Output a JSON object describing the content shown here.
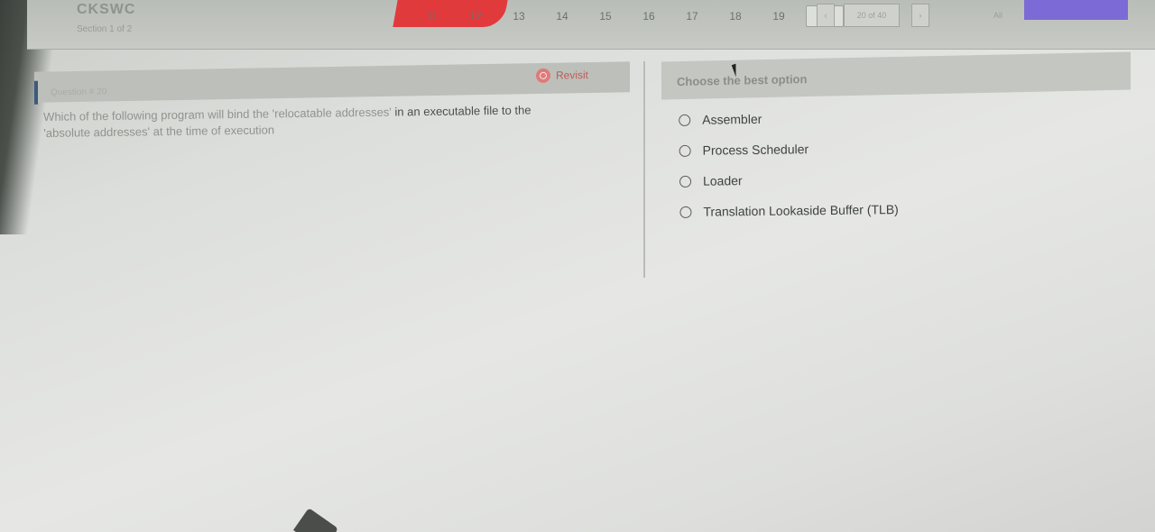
{
  "header": {
    "brand": "CKSWC",
    "section_label": "Section 1 of 2",
    "question_numbers": [
      "11",
      "12",
      "13",
      "14",
      "15",
      "16",
      "17",
      "18",
      "19"
    ],
    "current_question": "20",
    "prev_label": "‹",
    "page_indicator": "20 of 40",
    "next_label": "›",
    "all_label": "All"
  },
  "question": {
    "label": "Question # 20",
    "revisit_label": "Revisit",
    "text_faded_1": "Which of the following program will bind the 'relocatable addresses'",
    "text_clear_1": " in an executable file to the",
    "text_faded_2": "'absolute addresses' at the time of execution"
  },
  "options": {
    "title": "Choose the best option",
    "items": [
      {
        "label": "Assembler"
      },
      {
        "label": "Process Scheduler"
      },
      {
        "label": "Loader"
      },
      {
        "label": "Translation Lookaside Buffer (TLB)"
      }
    ]
  },
  "colors": {
    "accent_red": "#e13a3c",
    "accent_purple": "#7c6ad6"
  }
}
